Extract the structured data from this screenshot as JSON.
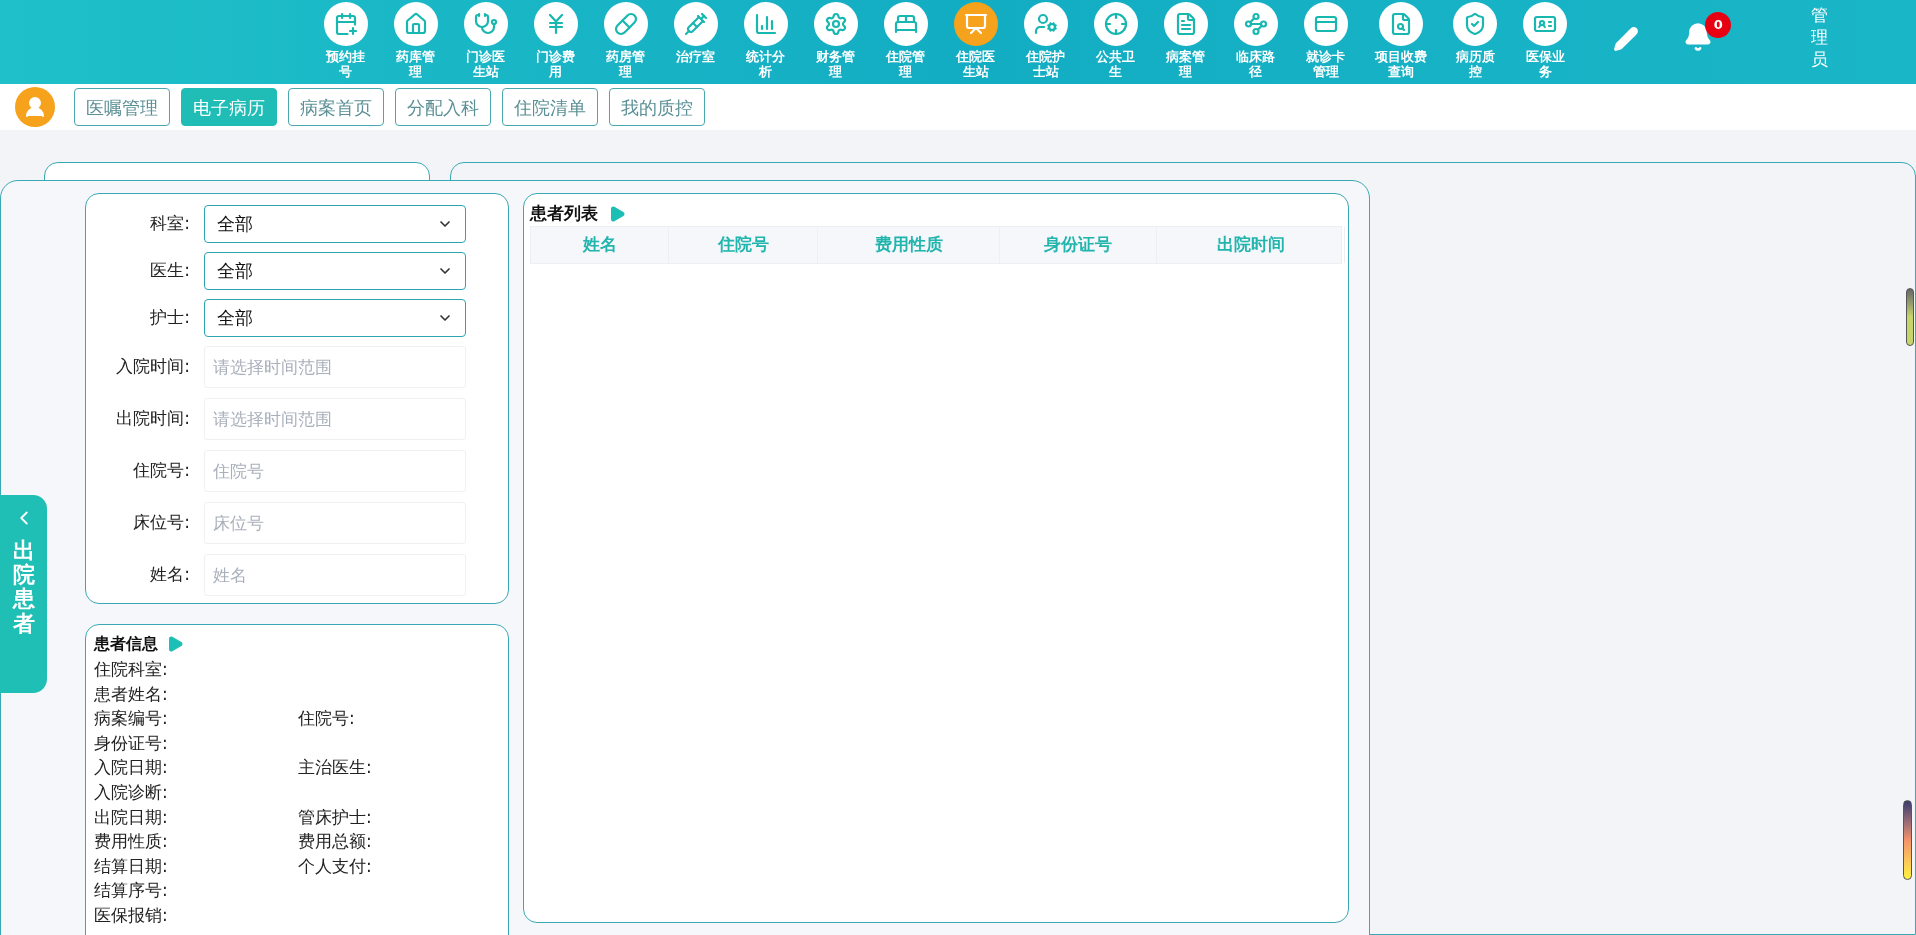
{
  "top_nav": {
    "items": [
      {
        "label": "预约挂号",
        "selected": false
      },
      {
        "label": "药库管理",
        "selected": false
      },
      {
        "label": "门诊医生站",
        "selected": false
      },
      {
        "label": "门诊费用",
        "selected": false
      },
      {
        "label": "药房管理",
        "selected": false
      },
      {
        "label": "治疗室",
        "selected": false
      },
      {
        "label": "统计分析",
        "selected": false
      },
      {
        "label": "财务管理",
        "selected": false
      },
      {
        "label": "住院管理",
        "selected": false
      },
      {
        "label": "住院医生站",
        "selected": true
      },
      {
        "label": "住院护士站",
        "selected": false
      },
      {
        "label": "公共卫生",
        "selected": false
      },
      {
        "label": "病案管理",
        "selected": false
      },
      {
        "label": "临床路径",
        "selected": false
      },
      {
        "label": "就诊卡管理",
        "selected": false
      },
      {
        "label": "项目收费查询",
        "selected": false
      },
      {
        "label": "病历质控",
        "selected": false
      },
      {
        "label": "医保业务",
        "selected": false
      }
    ],
    "notification_count": "0",
    "user": "管理员"
  },
  "tabs": [
    {
      "label": "医嘱管理",
      "selected": false
    },
    {
      "label": "电子病历",
      "selected": true
    },
    {
      "label": "病案首页",
      "selected": false
    },
    {
      "label": "分配入科",
      "selected": false
    },
    {
      "label": "住院清单",
      "selected": false
    },
    {
      "label": "我的质控",
      "selected": false
    }
  ],
  "discharged_tab": {
    "label": "出院患者"
  },
  "filters": [
    {
      "kind": "select",
      "label": "科室:",
      "value": "全部"
    },
    {
      "kind": "select",
      "label": "医生:",
      "value": "全部"
    },
    {
      "kind": "select",
      "label": "护士:",
      "value": "全部"
    },
    {
      "kind": "input",
      "label": "入院时间:",
      "placeholder": "请选择时间范围"
    },
    {
      "kind": "input",
      "label": "出院时间:",
      "placeholder": "请选择时间范围"
    },
    {
      "kind": "input",
      "label": "住院号:",
      "placeholder": "住院号"
    },
    {
      "kind": "input",
      "label": "床位号:",
      "placeholder": "床位号"
    },
    {
      "kind": "input",
      "label": "姓名:",
      "placeholder": "姓名"
    }
  ],
  "patient_info": {
    "title": "患者信息",
    "rows": [
      {
        "fields": [
          "住院科室:"
        ]
      },
      {
        "fields": [
          "患者姓名:"
        ]
      },
      {
        "fields": [
          "病案编号:",
          "住院号:"
        ]
      },
      {
        "fields": [
          "身份证号:"
        ]
      },
      {
        "fields": [
          "入院日期:",
          "主治医生:"
        ]
      },
      {
        "fields": [
          "入院诊断:"
        ]
      },
      {
        "fields": [
          "出院日期:",
          "管床护士:"
        ]
      },
      {
        "fields": [
          "费用性质:",
          "费用总额:"
        ]
      },
      {
        "fields": [
          "结算日期:",
          "个人支付:"
        ]
      },
      {
        "fields": [
          "结算序号:"
        ]
      },
      {
        "fields": [
          "医保报销:"
        ]
      }
    ]
  },
  "patient_list": {
    "title": "患者列表",
    "columns": [
      "姓名",
      "住院号",
      "费用性质",
      "身份证号",
      "出院时间"
    ]
  }
}
